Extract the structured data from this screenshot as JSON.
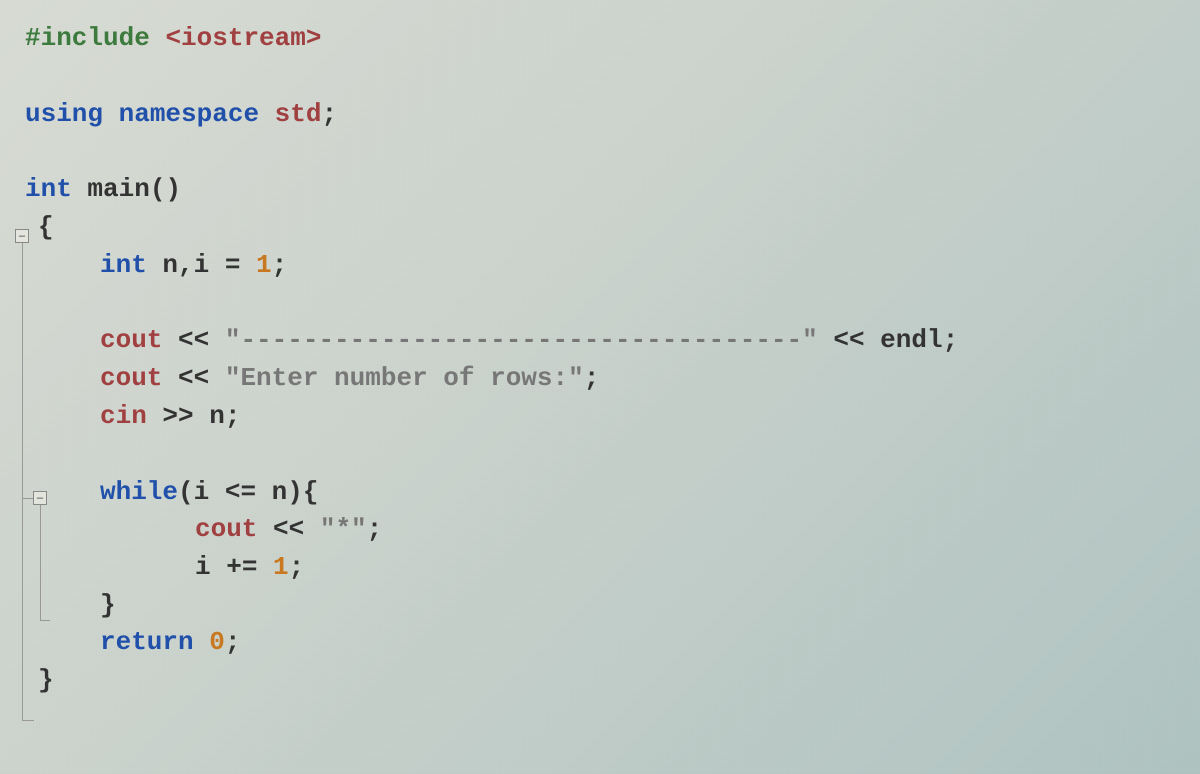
{
  "code": {
    "line1": {
      "include": "#include",
      "lt": "<",
      "header": "iostream",
      "gt": ">"
    },
    "line2": {
      "using": "using",
      "namespace": "namespace",
      "std": "std",
      "semi": ";"
    },
    "line3": {
      "int": "int",
      "main": "main",
      "parens": "()"
    },
    "line4": {
      "brace": "{"
    },
    "line5": {
      "int": "int",
      "vars": " n,i ",
      "eq": "=",
      "sp": " ",
      "num": "1",
      "semi": ";"
    },
    "line6": {
      "cout": "cout",
      "op": " << ",
      "str": "\"------------------------------------\"",
      "op2": " << ",
      "endl": "endl",
      "semi": ";"
    },
    "line7": {
      "cout": "cout",
      "op": " << ",
      "str": "\"Enter number of rows:\"",
      "semi": ";"
    },
    "line8": {
      "cin": "cin",
      "op": " >> ",
      "var": "n",
      "semi": ";"
    },
    "line9": {
      "while": "while",
      "open": "(",
      "var1": "i ",
      "op": "<=",
      "var2": " n",
      "close": ")",
      "brace": "{"
    },
    "line10": {
      "cout": "cout",
      "op": " << ",
      "str": "\"*\"",
      "semi": ";"
    },
    "line11": {
      "var": "i ",
      "op": "+=",
      "sp": " ",
      "num": "1",
      "semi": ";"
    },
    "line12": {
      "brace": "}"
    },
    "line13": {
      "return": "return",
      "sp": " ",
      "num": "0",
      "semi": ";"
    },
    "line14": {
      "brace": "}"
    }
  },
  "fold": {
    "minus": "−"
  }
}
